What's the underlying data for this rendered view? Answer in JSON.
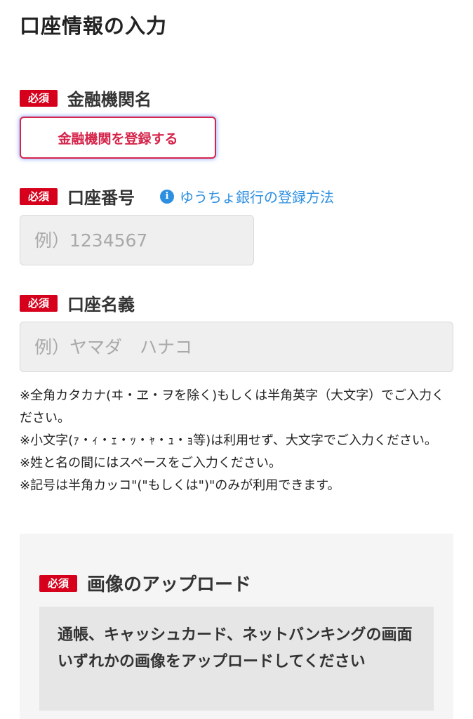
{
  "page_title": "口座情報の入力",
  "required_label": "必須",
  "bank": {
    "label": "金融機関名",
    "register_button": "金融機関を登録する"
  },
  "account_number": {
    "label": "口座番号",
    "help_link": "ゆうちょ銀行の登録方法",
    "placeholder": "例）1234567"
  },
  "account_name": {
    "label": "口座名義",
    "placeholder": "例）ヤマダ　ハナコ"
  },
  "notes": [
    "※全角カタカナ(ヰ・ヱ・ヲを除く)もしくは半角英字（大文字）でご入力ください。",
    "※小文字(ｧ・ｨ・ｪ・ｯ・ｬ・ｭ・ｮ等)は利用せず、大文字でご入力ください。",
    "※姓と名の間にはスペースをご入力ください。",
    "※記号は半角カッコ\"(\"もしくは\")\"のみが利用できます。"
  ],
  "upload": {
    "heading": "画像のアップロード",
    "instruction": "通帳、キャッシュカード、ネットバンキングの画面いずれかの画像をアップロードしてください"
  },
  "colors": {
    "required_badge": "#d6001c",
    "register_button": "#d6244a",
    "link": "#2d8fe0"
  },
  "icons": {
    "help_link_icon": "info-icon"
  }
}
